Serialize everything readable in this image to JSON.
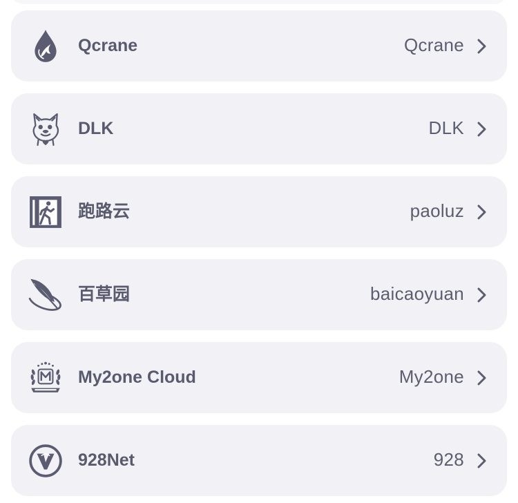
{
  "list": {
    "items": [
      {
        "title": "Qcrane",
        "value": "Qcrane",
        "icon": "water-drop-bird-icon"
      },
      {
        "title": "DLK",
        "value": "DLK",
        "icon": "doge-face-icon"
      },
      {
        "title": "跑路云",
        "value": "paoluz",
        "icon": "exit-sign-icon"
      },
      {
        "title": "百草园",
        "value": "baicaoyuan",
        "icon": "feather-orbit-icon"
      },
      {
        "title": "My2one Cloud",
        "value": "My2one",
        "icon": "laurel-badge-icon",
        "logo_lettering": "M"
      },
      {
        "title": "928Net",
        "value": "928",
        "icon": "circle-v-icon"
      }
    ],
    "trailing_icon": "chevron-right-icon"
  },
  "colors": {
    "page_background": "#ffffff",
    "card_background": "#f2f2f6",
    "text": "#595a6e",
    "icon": "#5b5b72"
  }
}
